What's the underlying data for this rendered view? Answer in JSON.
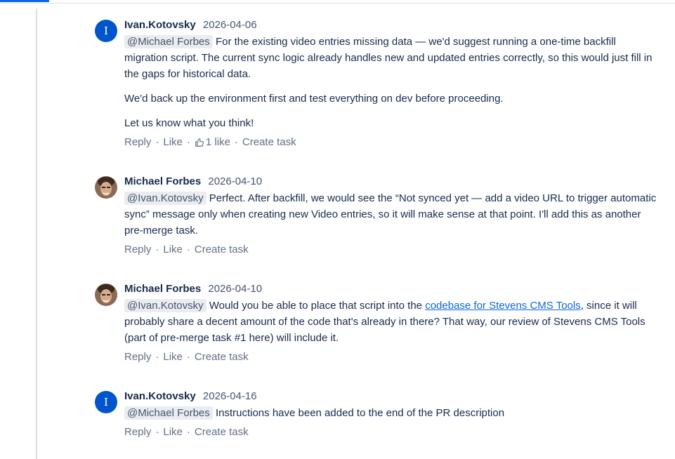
{
  "comments": [
    {
      "author": "Ivan.Kotovsky",
      "date": "2026-04-06",
      "avatar_initial": "I",
      "mention": "@Michael Forbes",
      "text": "For the existing video entries missing data — we'd suggest running a one-time backfill migration script. The current sync logic already handles new and updated entries correctly, so this would just fill in the gaps for historical data.",
      "paragraph2": "We'd back up the environment first and test everything on dev before proceeding.",
      "paragraph3": "Let us know what you think!",
      "reply": "Reply",
      "like": "Like",
      "likes_count": "1 like",
      "create_task": "Create task"
    },
    {
      "author": "Michael Forbes",
      "date": "2026-04-10",
      "mention": "@Ivan.Kotovsky",
      "text": "Perfect. After backfill, we would see the “Not synced yet — add a video URL to trigger automatic sync” message only when creating new Video entries, so it will make sense at that point. I'll add this as another pre-merge task.",
      "reply": "Reply",
      "like": "Like",
      "create_task": "Create task"
    },
    {
      "author": "Michael Forbes",
      "date": "2026-04-10",
      "mention": "@Ivan.Kotovsky",
      "text_before": "Would you be able to place that script into the",
      "link_text": "codebase for Stevens CMS Tools",
      "text_after": ", since it will probably share a decent amount of the code that's already in there? That way, our review of Stevens CMS Tools (part of pre-merge task #1 here) will include it.",
      "reply": "Reply",
      "like": "Like",
      "create_task": "Create task"
    },
    {
      "author": "Ivan.Kotovsky",
      "date": "2026-04-16",
      "avatar_initial": "I",
      "mention": "@Michael Forbes",
      "text": "Instructions have been added to the end of the PR description",
      "reply": "Reply",
      "like": "Like",
      "create_task": "Create task"
    }
  ],
  "colors": {
    "accent": "#0c66e4",
    "avatar_blue": "#0055cc",
    "mention_bg": "#ebecf0"
  },
  "icons": {
    "like": "thumbs-up-icon"
  }
}
